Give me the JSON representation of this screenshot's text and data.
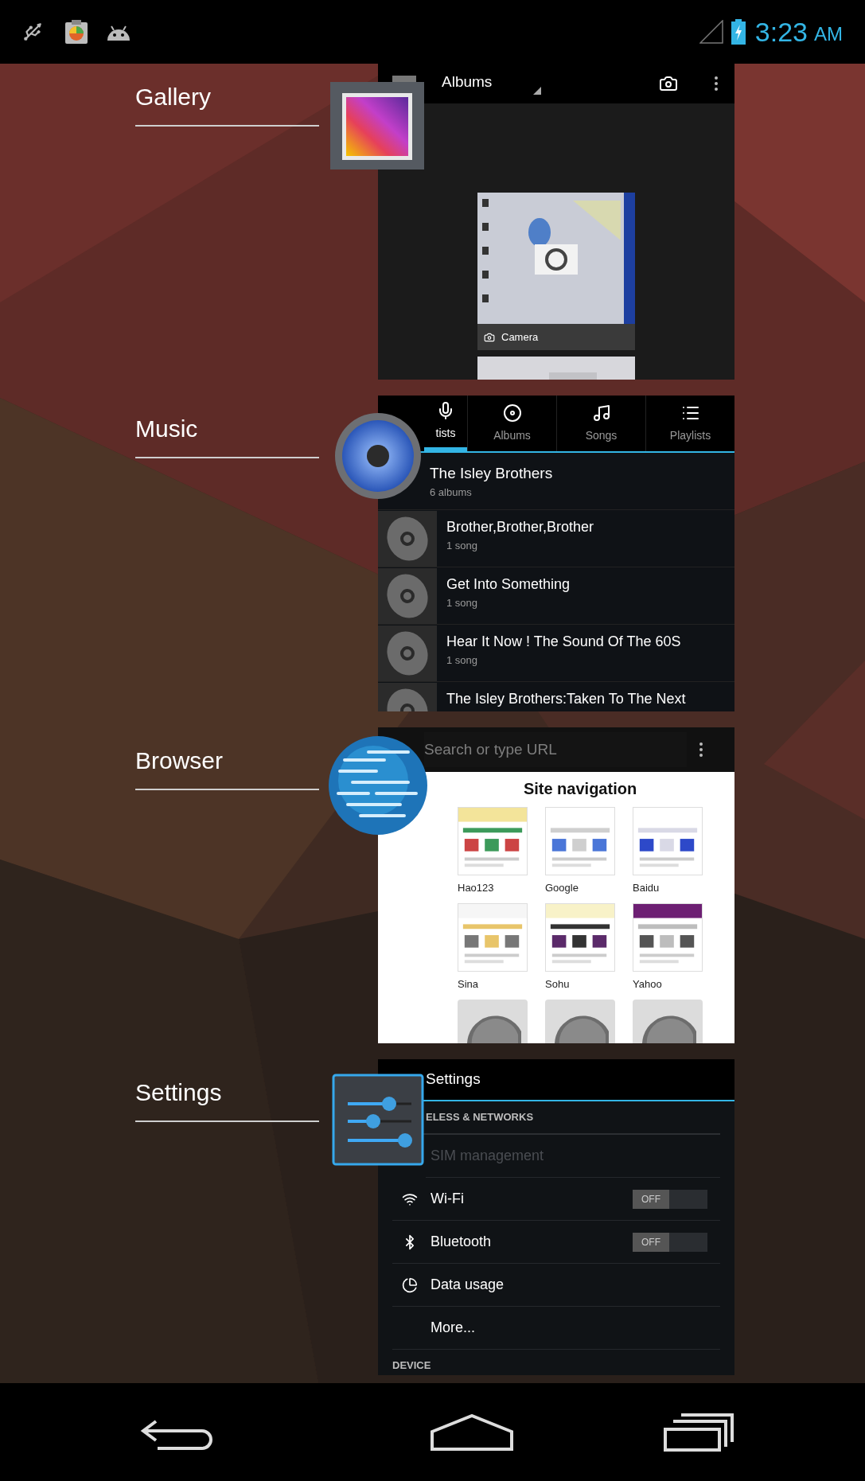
{
  "status_bar": {
    "time": "3:23",
    "meridiem": "AM"
  },
  "recent_apps": [
    {
      "kind": "gallery",
      "label": "Gallery",
      "header_title": "Albums",
      "albums": [
        {
          "caption": "Camera"
        }
      ]
    },
    {
      "kind": "music",
      "label": "Music",
      "tabs": [
        {
          "label": "tists",
          "selected": true
        },
        {
          "label": "Albums",
          "selected": false
        },
        {
          "label": "Songs",
          "selected": false
        },
        {
          "label": "Playlists",
          "selected": false
        }
      ],
      "artist": {
        "name": "The Isley Brothers",
        "detail": "6 albums"
      },
      "albums": [
        {
          "title": "Brother,Brother,Brother",
          "detail": "1 song"
        },
        {
          "title": "Get Into Something",
          "detail": "1 song"
        },
        {
          "title": "Hear It Now ! The Sound Of The 60S",
          "detail": "1 song"
        },
        {
          "title": "The Isley Brothers:Taken To The Next"
        }
      ]
    },
    {
      "kind": "browser",
      "label": "Browser",
      "address_bar": {
        "placeholder": "Search or type URL"
      },
      "page_title": "Site navigation",
      "tiles": [
        {
          "kind": "site",
          "label": "Hao123"
        },
        {
          "kind": "site",
          "label": "Google"
        },
        {
          "kind": "site",
          "label": "Baidu"
        },
        {
          "kind": "site",
          "label": "Sina"
        },
        {
          "kind": "site",
          "label": "Sohu"
        },
        {
          "kind": "site",
          "label": "Yahoo"
        },
        {
          "kind": "empty"
        },
        {
          "kind": "empty"
        },
        {
          "kind": "empty"
        }
      ]
    },
    {
      "kind": "settings",
      "label": "Settings",
      "title": "Settings",
      "items": [
        {
          "kind": "header",
          "text": "ELESS & NETWORKS"
        },
        {
          "kind": "item",
          "text": "SIM management",
          "disabled": true
        },
        {
          "kind": "toggle",
          "text": "Wi-Fi",
          "disabled": false,
          "on": false,
          "state_label": "OFF"
        },
        {
          "kind": "toggle",
          "text": "Bluetooth",
          "disabled": false,
          "on": false,
          "state_label": "OFF"
        },
        {
          "kind": "item",
          "text": "Data usage",
          "disabled": false
        },
        {
          "kind": "item",
          "text": "More...",
          "disabled": false
        },
        {
          "kind": "header",
          "text": "DEVICE"
        }
      ]
    }
  ]
}
